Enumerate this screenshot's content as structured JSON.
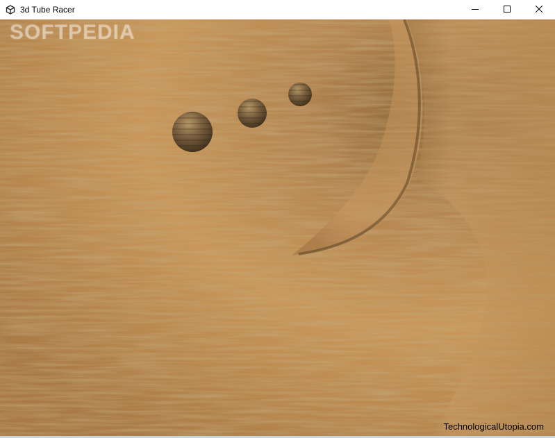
{
  "window": {
    "title": "3d Tube Racer",
    "app_icon": "unity-logo-icon",
    "controls": {
      "minimize_icon": "minimize-icon",
      "maximize_icon": "maximize-icon",
      "close_icon": "close-icon"
    }
  },
  "game": {
    "watermark": "SOFTPEDIA",
    "credit": "TechnologicalUtopia.com",
    "colors": {
      "tube_light": "#d9a968",
      "tube_mid": "#b8894e",
      "tube_dark": "#8a6535",
      "tunnel_shadow": "#6e5230",
      "sphere_light": "#b59867",
      "sphere_dark": "#3d2e1a"
    },
    "spheres_count": 3
  }
}
